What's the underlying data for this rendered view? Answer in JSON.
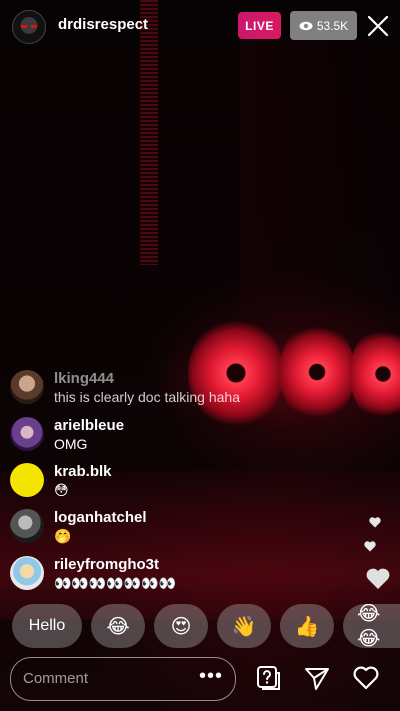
{
  "header": {
    "username": "drdisrespect",
    "live_label": "LIVE",
    "viewer_count": "53.5K"
  },
  "comments": [
    {
      "user": "lking444",
      "text": "this is clearly doc talking haha"
    },
    {
      "user": "arielbleue",
      "text": "OMG"
    },
    {
      "user": "krab.blk",
      "text": "😳"
    },
    {
      "user": "loganhatchel",
      "text": "🤭"
    },
    {
      "user": "rileyfromgho3t",
      "text": "👀👀👀👀👀👀👀"
    }
  ],
  "quick_reactions": [
    "Hello",
    "😂",
    "😍",
    "👋",
    "👍",
    "😂😂"
  ],
  "composer": {
    "placeholder": "Comment",
    "more_label": "•••"
  },
  "colors": {
    "live_badge": "#d81b60",
    "viewer_badge": "#969696",
    "fan_glow": "#e01a32"
  }
}
